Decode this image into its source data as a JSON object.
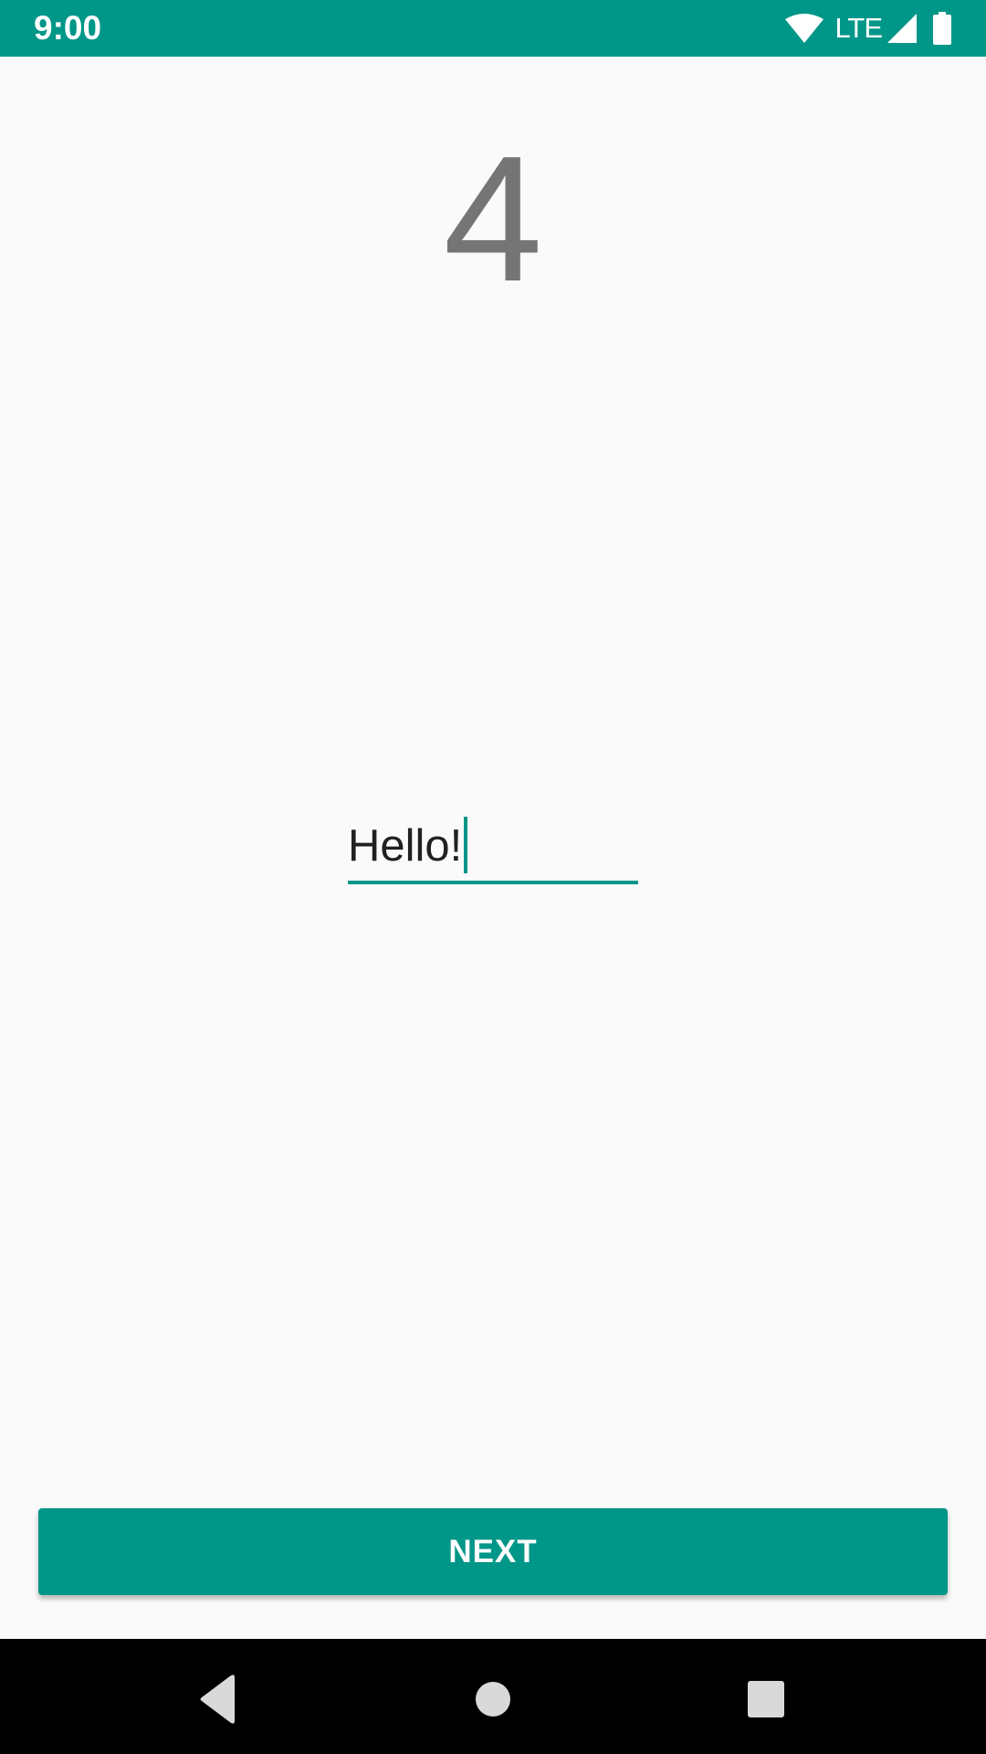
{
  "status_bar": {
    "time": "9:00",
    "network_label": "LTE",
    "icons": [
      "wifi-icon",
      "signal-icon",
      "battery-icon"
    ],
    "background_color": "#009688"
  },
  "main": {
    "counter": "4",
    "input": {
      "value": "Hello!"
    },
    "next_button_label": "NEXT",
    "accent_color": "#009688"
  },
  "nav_bar": {
    "icons": [
      "back-icon",
      "home-icon",
      "recents-icon"
    ]
  }
}
